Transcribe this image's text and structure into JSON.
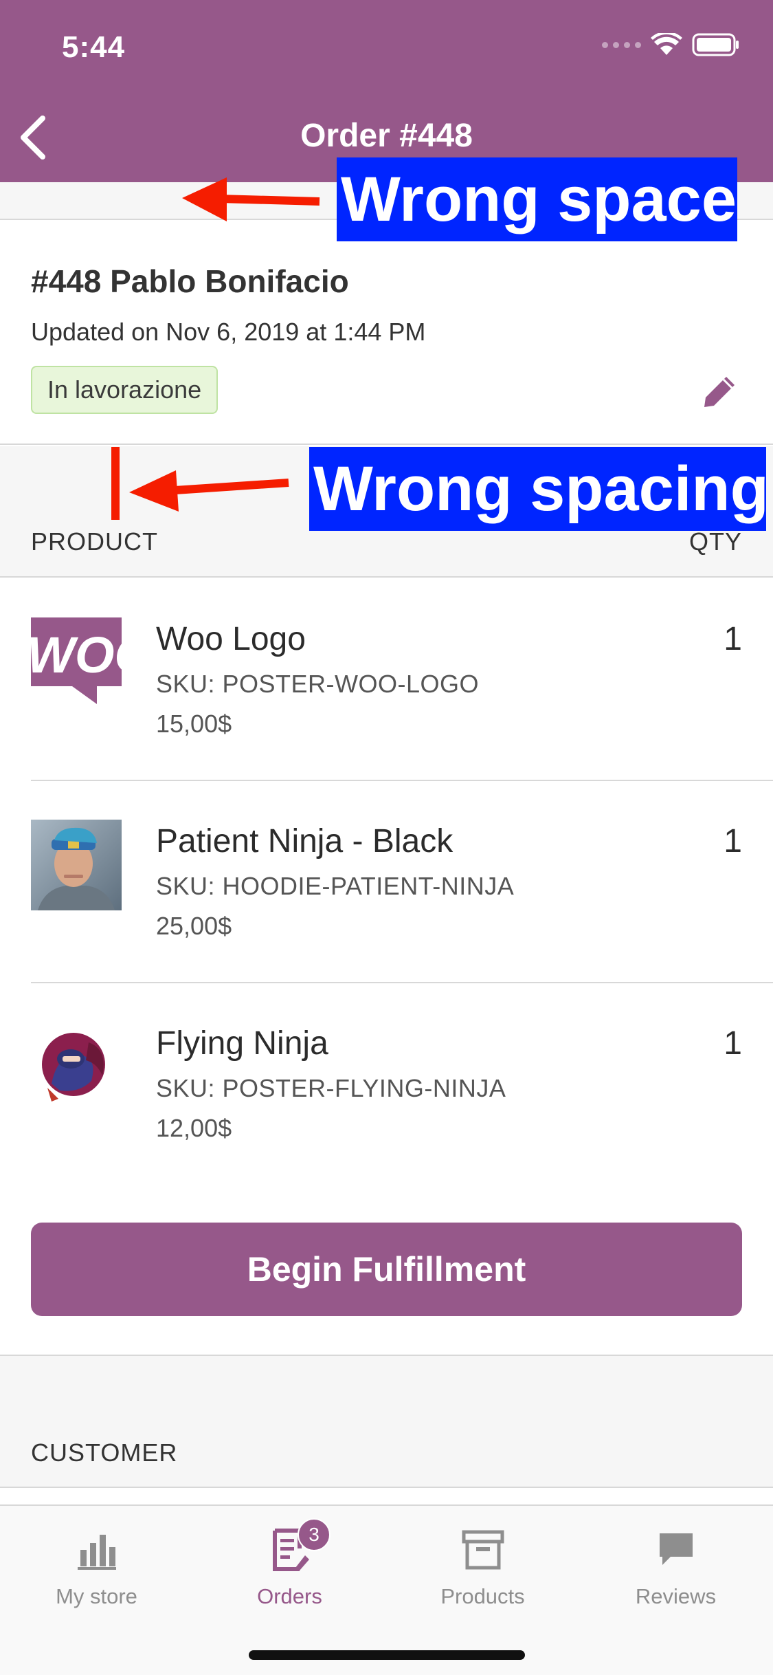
{
  "status_bar": {
    "time": "5:44"
  },
  "nav": {
    "title": "Order #448"
  },
  "annotations": [
    "Wrong space",
    "Wrong spacing"
  ],
  "order": {
    "name": "#448 Pablo Bonifacio",
    "updated": "Updated on Nov 6, 2019 at 1:44 PM",
    "status": "In lavorazione"
  },
  "products_header": {
    "product": "PRODUCT",
    "qty": "QTY"
  },
  "items": [
    {
      "name": "Woo Logo",
      "sku": "SKU: POSTER-WOO-LOGO",
      "price": "15,00$",
      "qty": "1",
      "thumb_text": "WOO"
    },
    {
      "name": "Patient Ninja - Black",
      "sku": "SKU: HOODIE-PATIENT-NINJA",
      "price": "25,00$",
      "qty": "1"
    },
    {
      "name": "Flying Ninja",
      "sku": "SKU: POSTER-FLYING-NINJA",
      "price": "12,00$",
      "qty": "1"
    }
  ],
  "fulfill": {
    "label": "Begin Fulfillment"
  },
  "customer": {
    "label": "CUSTOMER"
  },
  "tabs": [
    {
      "label": "My store",
      "icon": "bar-chart-icon"
    },
    {
      "label": "Orders",
      "icon": "orders-icon",
      "badge": "3"
    },
    {
      "label": "Products",
      "icon": "archive-box-icon"
    },
    {
      "label": "Reviews",
      "icon": "speech-bubble-icon"
    }
  ],
  "colors": {
    "brand": "#96588a",
    "annotation_blue": "#0025ff",
    "annotation_red": "#f51d00"
  }
}
